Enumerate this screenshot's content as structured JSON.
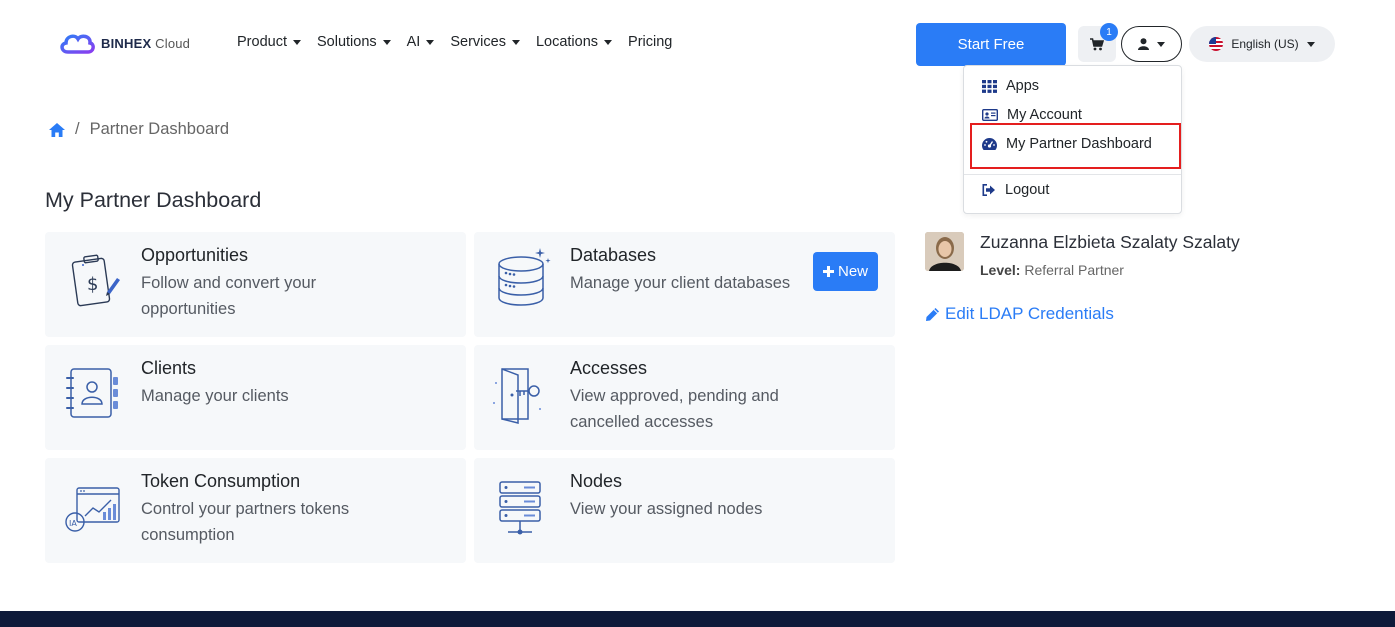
{
  "header": {
    "logo_bold": "BINHEX",
    "logo_light": "Cloud",
    "nav": [
      {
        "label": "Product",
        "caret": true
      },
      {
        "label": "Solutions",
        "caret": true
      },
      {
        "label": "AI",
        "caret": true
      },
      {
        "label": "Services",
        "caret": true
      },
      {
        "label": "Locations",
        "caret": true
      },
      {
        "label": "Pricing",
        "caret": false
      }
    ],
    "start_free_label": "Start Free",
    "cart_count": "1",
    "language_label": "English (US)"
  },
  "user_menu": {
    "items": [
      {
        "label": "Apps",
        "icon": "grid-icon"
      },
      {
        "label": "My Account",
        "icon": "id-card-icon"
      },
      {
        "label": "My Partner Dashboard",
        "icon": "dashboard-icon",
        "highlighted": true
      },
      {
        "label": "Logout",
        "icon": "logout-icon"
      }
    ]
  },
  "breadcrumb": {
    "current": "Partner Dashboard"
  },
  "page": {
    "title": "My Partner Dashboard"
  },
  "cards": [
    {
      "title": "Opportunities",
      "desc": "Follow and convert your opportunities",
      "icon": "opportunities-icon"
    },
    {
      "title": "Databases",
      "desc": "Manage your client databases",
      "icon": "database-icon",
      "button": "New"
    },
    {
      "title": "Clients",
      "desc": "Manage your clients",
      "icon": "clients-icon"
    },
    {
      "title": "Accesses",
      "desc": "View approved, pending and cancelled accesses",
      "icon": "key-door-icon"
    },
    {
      "title": "Token Consumption",
      "desc": "Control your partners tokens consumption",
      "icon": "token-chart-icon"
    },
    {
      "title": "Nodes",
      "desc": "View your assigned nodes",
      "icon": "server-icon"
    }
  ],
  "profile": {
    "name": "Zuzanna Elzbieta Szalaty Szalaty",
    "level_label": "Level:",
    "level_value": "Referral Partner",
    "edit_ldap_label": "Edit LDAP Credentials"
  },
  "colors": {
    "accent": "#2a7cf6",
    "highlight": "#e41e1e",
    "footer": "#0e1a3a"
  }
}
